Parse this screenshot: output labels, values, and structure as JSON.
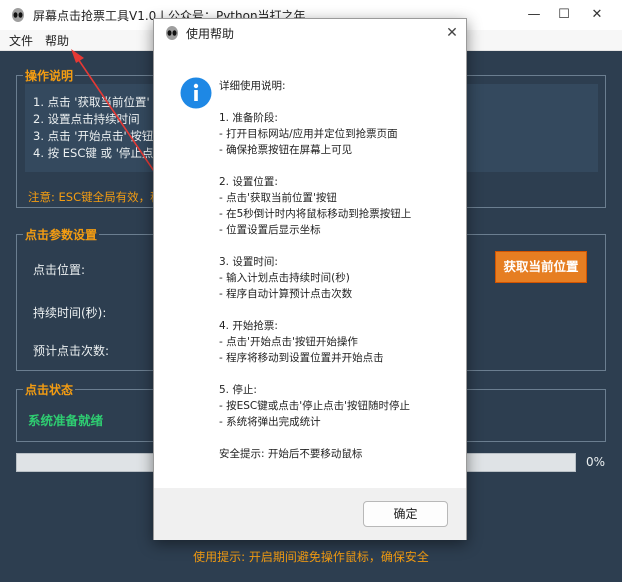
{
  "window": {
    "title": "屏幕点击抢票工具V1.0 | 公众号：Python当打之年",
    "minimize": "—",
    "maximize": "☐",
    "close": "✕"
  },
  "menu": {
    "file": "文件",
    "help": "帮助"
  },
  "instructions": {
    "title": "操作说明",
    "lines": [
      "1. 点击 '获取当前位置' 按钮，5秒内将鼠标移动到目标位置",
      "2. 设置点击持续时间",
      "3. 点击 '开始点击' 按钮开始操作",
      "4. 按 ESC键 或 '停止点击' 按钮停止操作"
    ],
    "note": "注意: ESC键全局有效，程序最小化时也可以停止"
  },
  "params": {
    "title": "点击参数设置",
    "position_label": "点击位置:",
    "duration_label": "持续时间(秒):",
    "count_label": "预计点击次数:",
    "get_position_button": "获取当前位置"
  },
  "status": {
    "title": "点击状态",
    "text": "系统准备就绪"
  },
  "progress": {
    "value": 0,
    "label": "0%"
  },
  "bottom_tip": "使用提示: 开启期间避免操作鼠标，确保安全",
  "dialog": {
    "title": "使用帮助",
    "close": "✕",
    "lines": [
      "详细使用说明:",
      "",
      "1. 准备阶段:",
      "  - 打开目标网站/应用并定位到抢票页面",
      "  - 确保抢票按钮在屏幕上可见",
      "",
      "2. 设置位置:",
      "  - 点击'获取当前位置'按钮",
      "  - 在5秒倒计时内将鼠标移动到抢票按钮上",
      "  - 位置设置后显示坐标",
      "",
      "3. 设置时间:",
      "  - 输入计划点击持续时间(秒)",
      "  - 程序自动计算预计点击次数",
      "",
      "4. 开始抢票:",
      "  - 点击'开始点击'按钮开始操作",
      "  - 程序将移动到设置位置并开始点击",
      "",
      "5. 停止:",
      "  - 按ESC键或点击'停止点击'按钮随时停止",
      "  - 系统将弹出完成统计",
      "",
      "安全提示: 开始后不要移动鼠标"
    ],
    "ok_button": "确定"
  },
  "colors": {
    "background": "#2d3e50",
    "accent": "#f39c12",
    "button_orange": "#e67e22",
    "status_green": "#2ecc71",
    "info_blue": "#1e88e5",
    "arrow_red": "#e53935"
  },
  "icons": {
    "app": "alien-icon",
    "info": "info-icon",
    "annotation": "red-arrow"
  }
}
